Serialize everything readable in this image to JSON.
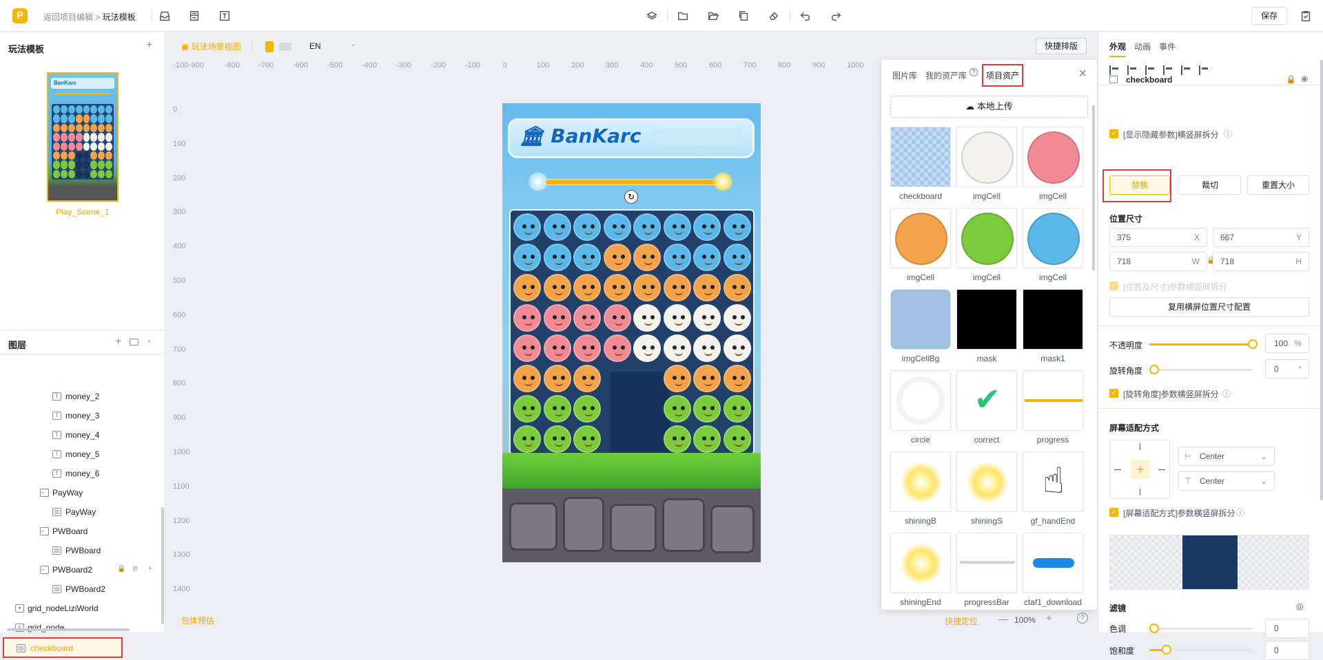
{
  "topbar": {
    "logo_letter": "P",
    "breadcrumb_back": "返回项目编辑",
    "breadcrumb_sep": ">",
    "breadcrumb_current": "玩法模板",
    "save_label": "保存"
  },
  "left_panel": {
    "templates_title": "玩法模板",
    "scene_label": "Play_Scene_1",
    "layers_title": "图层",
    "layers": [
      {
        "label": "money_2",
        "icon": "text-icon",
        "indent": 2
      },
      {
        "label": "money_3",
        "icon": "text-icon",
        "indent": 2
      },
      {
        "label": "money_4",
        "icon": "text-icon",
        "indent": 2
      },
      {
        "label": "money_5",
        "icon": "text-icon",
        "indent": 2
      },
      {
        "label": "money_6",
        "icon": "text-icon",
        "indent": 2
      },
      {
        "label": "PayWay",
        "icon": "folder-icon",
        "indent": 1
      },
      {
        "label": "PayWay",
        "icon": "image-icon",
        "indent": 2
      },
      {
        "label": "PWBoard",
        "icon": "folder-icon",
        "indent": 1
      },
      {
        "label": "PWBoard",
        "icon": "image-icon",
        "indent": 2
      },
      {
        "label": "PWBoard2",
        "icon": "folder-icon",
        "indent": 1
      },
      {
        "label": "PWBoard2",
        "icon": "image-icon",
        "indent": 2
      },
      {
        "label": "grid_nodeLiziWorld",
        "icon": "particle-icon",
        "indent": 0
      },
      {
        "label": "grid_node",
        "icon": "grid-icon",
        "indent": 0
      },
      {
        "label": "checkboard",
        "icon": "image-icon",
        "indent": 0
      }
    ]
  },
  "canvas": {
    "view_tab": "玩法场景视图",
    "language": "EN",
    "quick_layout": "快捷排版",
    "ruler_x": [
      "-100",
      "-900",
      "-800",
      "-700",
      "-600",
      "-500",
      "-400",
      "-300",
      "-200",
      "-100",
      "0",
      "100",
      "200",
      "300",
      "400",
      "500",
      "600",
      "700",
      "800",
      "900",
      "1000"
    ],
    "ruler_y": [
      "0",
      "100",
      "200",
      "300",
      "400",
      "500",
      "600",
      "700",
      "800",
      "900",
      "1000",
      "1100",
      "1200",
      "1300",
      "1400"
    ],
    "game_title": "BanKarc",
    "bottom_left": "包体预估",
    "bottom_locate": "快捷定位",
    "zoom": "100%"
  },
  "assets_panel": {
    "tabs": [
      "图片库",
      "我的资产库",
      "项目资产"
    ],
    "upload_label": "本地上传",
    "items": [
      {
        "name": "checkboard",
        "kind": "checker"
      },
      {
        "name": "imgCell",
        "kind": "panda"
      },
      {
        "name": "imgCell",
        "kind": "pig"
      },
      {
        "name": "imgCell",
        "kind": "tiger"
      },
      {
        "name": "imgCell",
        "kind": "frog"
      },
      {
        "name": "imgCell",
        "kind": "bird"
      },
      {
        "name": "imgCellBg",
        "kind": "cellbg"
      },
      {
        "name": "mask",
        "kind": "black"
      },
      {
        "name": "mask1",
        "kind": "black"
      },
      {
        "name": "circle",
        "kind": "circle"
      },
      {
        "name": "correct",
        "kind": "correct"
      },
      {
        "name": "progress",
        "kind": "progress"
      },
      {
        "name": "shiningB",
        "kind": "glow"
      },
      {
        "name": "shiningS",
        "kind": "glow"
      },
      {
        "name": "gf_handEnd",
        "kind": "hand"
      },
      {
        "name": "shiningEnd",
        "kind": "glow"
      },
      {
        "name": "progressBar",
        "kind": "bar"
      },
      {
        "name": "ctaf1_download",
        "kind": "cta"
      }
    ]
  },
  "inspector": {
    "tabs": [
      "外观",
      "动画",
      "事件"
    ],
    "node_name": "checkboard",
    "show_hidden_params": "[显示隐藏参数]横竖屏拆分",
    "replace": "替换",
    "crop": "裁切",
    "reset_size": "重置大小",
    "pos_size_title": "位置尺寸",
    "x_value": "375",
    "x_label": "X",
    "y_value": "667",
    "y_label": "Y",
    "w_value": "718",
    "w_label": "W",
    "h_value": "718",
    "h_label": "H",
    "pos_split": "[位置及尺寸]参数横竖屏拆分",
    "reuse_landscape": "复用横屏位置尺寸配置",
    "opacity_label": "不透明度",
    "opacity_value": "100",
    "opacity_unit": "%",
    "rotation_label": "旋转角度",
    "rotation_value": "0",
    "rotation_unit": "°",
    "rotation_split": "[旋转角度]参数横竖屏拆分",
    "screen_fit_title": "屏幕适配方式",
    "fit_h": "Center",
    "fit_v": "Center",
    "fit_split": "[屏幕适配方式]参数横竖屏拆分",
    "filter_title": "滤镜",
    "hue_label": "色调",
    "hue_value": "0",
    "saturation_label": "饱和度",
    "saturation_value": "0"
  }
}
